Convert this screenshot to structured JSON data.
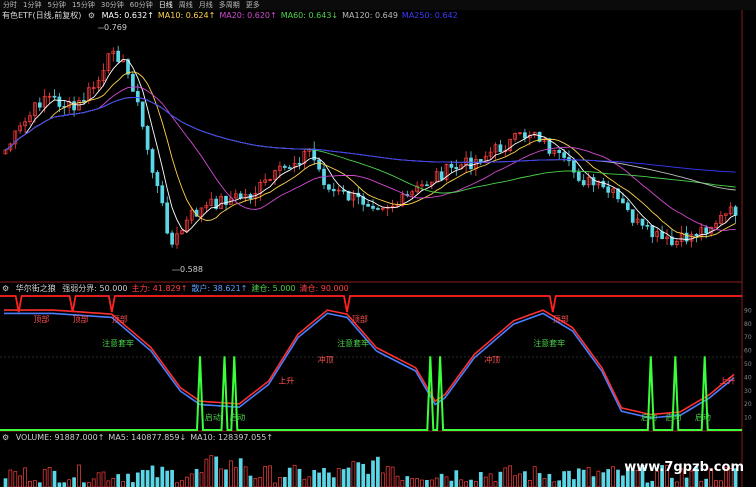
{
  "toolbar": {
    "items": [
      "分时",
      "1分钟",
      "5分钟",
      "15分钟",
      "30分钟",
      "60分钟",
      "日线",
      "周线",
      "月线",
      "多周期",
      "更多"
    ],
    "active_index": 6
  },
  "main_panel": {
    "symbol": "有色ETF(日线,前复权)",
    "ma_labels": [
      {
        "text": "MA5: 0.632↑",
        "color": "#ffffff"
      },
      {
        "text": "MA10: 0.624↑",
        "color": "#ffd24a"
      },
      {
        "text": "MA20: 0.620↑",
        "color": "#d24ad2"
      },
      {
        "text": "MA60: 0.643↓",
        "color": "#4ad24a"
      },
      {
        "text": "MA120: 0.649",
        "color": "#bbbbbb"
      },
      {
        "text": "MA250: 0.642",
        "color": "#3a3aff"
      }
    ],
    "high_label": "0.769",
    "low_label": "0.588"
  },
  "indicator_panel": {
    "title": "华尔街之狼",
    "items": [
      {
        "text": "强弱分界: 50.000",
        "color": "#cccccc"
      },
      {
        "text": "主力: 41.829↑",
        "color": "#ff4040"
      },
      {
        "text": "散户: 38.621↑",
        "color": "#5aa0ff"
      },
      {
        "text": "建仓: 5.000",
        "color": "#4ad24a"
      },
      {
        "text": "清仓: 90.000",
        "color": "#ff4040"
      }
    ],
    "annotations": [
      {
        "text": "顶部",
        "color": "#ff5050"
      },
      {
        "text": "顶部",
        "color": "#ff5050"
      },
      {
        "text": "顶部",
        "color": "#ff5050"
      },
      {
        "text": "注意套牢",
        "color": "#4ad24a"
      },
      {
        "text": "顶部",
        "color": "#ff5050"
      },
      {
        "text": "注意套牢",
        "color": "#4ad24a"
      },
      {
        "text": "冲顶",
        "color": "#ff5050"
      },
      {
        "text": "上升",
        "color": "#ff5050"
      },
      {
        "text": "顶部",
        "color": "#ff5050"
      },
      {
        "text": "注意套牢",
        "color": "#4ad24a"
      },
      {
        "text": "冲顶",
        "color": "#ff5050"
      },
      {
        "text": "启动",
        "color": "#4ad24a"
      },
      {
        "text": "启动",
        "color": "#4ad24a"
      },
      {
        "text": "启动",
        "color": "#4ad24a"
      },
      {
        "text": "启动",
        "color": "#4ad24a"
      },
      {
        "text": "启动",
        "color": "#4ad24a"
      },
      {
        "text": "上升",
        "color": "#ff5050"
      }
    ],
    "axis_ticks": [
      "90",
      "80",
      "70",
      "60",
      "50",
      "40",
      "30",
      "20",
      "10"
    ]
  },
  "volume_panel": {
    "items": [
      {
        "text": "VOLUME: 91887.000↑",
        "color": "#cccccc"
      },
      {
        "text": "MA5: 140877.859↓",
        "color": "#cccccc"
      },
      {
        "text": "MA10: 128397.055↑",
        "color": "#cccccc"
      }
    ]
  },
  "watermark": "www.7gpzb.com"
}
